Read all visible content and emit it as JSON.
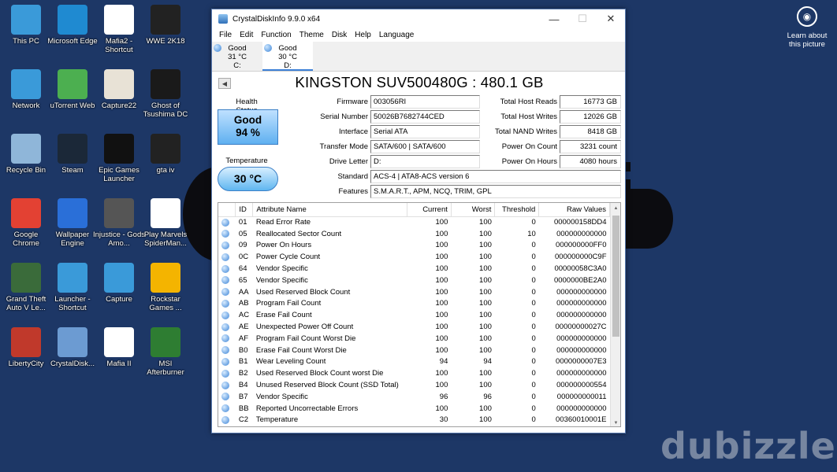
{
  "desktop": {
    "icons": [
      {
        "label": "This PC",
        "color": "#3a9ad9"
      },
      {
        "label": "Microsoft Edge",
        "color": "#1f8ad1"
      },
      {
        "label": "Mafia2 - Shortcut",
        "color": "#ffffff"
      },
      {
        "label": "WWE 2K18",
        "color": "#222222"
      },
      {
        "label": "Network",
        "color": "#3a9ad9"
      },
      {
        "label": "uTorrent Web",
        "color": "#4caf50"
      },
      {
        "label": "Capture22",
        "color": "#e8e2d6"
      },
      {
        "label": "Ghost of Tsushima DC",
        "color": "#1a1a1a"
      },
      {
        "label": "Recycle Bin",
        "color": "#8fb6d9"
      },
      {
        "label": "Steam",
        "color": "#1b2838"
      },
      {
        "label": "Epic Games Launcher",
        "color": "#111111"
      },
      {
        "label": "gta iv",
        "color": "#222222"
      },
      {
        "label": "Google Chrome",
        "color": "#e34133"
      },
      {
        "label": "Wallpaper Engine",
        "color": "#2a6fd8"
      },
      {
        "label": "Injustice - Gods Amo...",
        "color": "#555555"
      },
      {
        "label": "Play Marvels SpiderMan...",
        "color": "#ffffff"
      },
      {
        "label": "Grand Theft Auto V Le...",
        "color": "#3a6b3a"
      },
      {
        "label": "Launcher - Shortcut",
        "color": "#3a9ad9"
      },
      {
        "label": "Capture",
        "color": "#3a9ad9"
      },
      {
        "label": "Rockstar Games ...",
        "color": "#f4b400"
      },
      {
        "label": "LibertyCity",
        "color": "#c0392b"
      },
      {
        "label": "CrystalDisk...",
        "color": "#6c9bd2"
      },
      {
        "label": "Mafia II",
        "color": "#ffffff"
      },
      {
        "label": "MSI Afterburner",
        "color": "#2e7d32"
      }
    ],
    "learn_label": "Learn about this picture",
    "watermark": "dubizzle"
  },
  "window": {
    "title": "CrystalDiskInfo 9.9.0 x64",
    "menu": [
      "File",
      "Edit",
      "Function",
      "Theme",
      "Disk",
      "Help",
      "Language"
    ],
    "drives": [
      {
        "status": "Good",
        "temp": "31 °C",
        "letter": "C:"
      },
      {
        "status": "Good",
        "temp": "30 °C",
        "letter": "D:"
      }
    ],
    "disk_name": "KINGSTON SUV500480G : 480.1 GB",
    "health_label": "Health Status",
    "health_status": "Good",
    "health_percent": "94 %",
    "temp_label": "Temperature",
    "temperature": "30 °C",
    "left_fields": [
      {
        "label": "Firmware",
        "value": "003056RI"
      },
      {
        "label": "Serial Number",
        "value": "50026B7682744CED"
      },
      {
        "label": "Interface",
        "value": "Serial ATA"
      },
      {
        "label": "Transfer Mode",
        "value": "SATA/600 | SATA/600"
      },
      {
        "label": "Drive Letter",
        "value": "D:"
      },
      {
        "label": "Standard",
        "value": "ACS-4 | ATA8-ACS version 6"
      },
      {
        "label": "Features",
        "value": "S.M.A.R.T., APM, NCQ, TRIM, GPL"
      }
    ],
    "right_fields": [
      {
        "label": "Total Host Reads",
        "value": "16773 GB"
      },
      {
        "label": "Total Host Writes",
        "value": "12026 GB"
      },
      {
        "label": "Total NAND Writes",
        "value": "8418 GB"
      },
      {
        "label": "Power On Count",
        "value": "3231 count"
      },
      {
        "label": "Power On Hours",
        "value": "4080 hours"
      }
    ],
    "columns": [
      "ID",
      "Attribute Name",
      "Current",
      "Worst",
      "Threshold",
      "Raw Values"
    ],
    "rows": [
      [
        "01",
        "Read Error Rate",
        "100",
        "100",
        "0",
        "000000158DD4"
      ],
      [
        "05",
        "Reallocated Sector Count",
        "100",
        "100",
        "10",
        "000000000000"
      ],
      [
        "09",
        "Power On Hours",
        "100",
        "100",
        "0",
        "000000000FF0"
      ],
      [
        "0C",
        "Power Cycle Count",
        "100",
        "100",
        "0",
        "000000000C9F"
      ],
      [
        "64",
        "Vendor Specific",
        "100",
        "100",
        "0",
        "00000058C3A0"
      ],
      [
        "65",
        "Vendor Specific",
        "100",
        "100",
        "0",
        "0000000BE2A0"
      ],
      [
        "AA",
        "Used Reserved Block Count",
        "100",
        "100",
        "0",
        "000000000000"
      ],
      [
        "AB",
        "Program Fail Count",
        "100",
        "100",
        "0",
        "000000000000"
      ],
      [
        "AC",
        "Erase Fail Count",
        "100",
        "100",
        "0",
        "000000000000"
      ],
      [
        "AE",
        "Unexpected Power Off Count",
        "100",
        "100",
        "0",
        "00000000027C"
      ],
      [
        "AF",
        "Program Fail Count Worst Die",
        "100",
        "100",
        "0",
        "000000000000"
      ],
      [
        "B0",
        "Erase Fail Count Worst Die",
        "100",
        "100",
        "0",
        "000000000000"
      ],
      [
        "B1",
        "Wear Leveling Count",
        "94",
        "94",
        "0",
        "0000000007E3"
      ],
      [
        "B2",
        "Used Reserved Block Count worst Die",
        "100",
        "100",
        "0",
        "000000000000"
      ],
      [
        "B4",
        "Unused Reserved Block Count (SSD Total)",
        "100",
        "100",
        "0",
        "000000000554"
      ],
      [
        "B7",
        "Vendor Specific",
        "96",
        "96",
        "0",
        "000000000011"
      ],
      [
        "BB",
        "Reported Uncorrectable Errors",
        "100",
        "100",
        "0",
        "000000000000"
      ],
      [
        "C2",
        "Temperature",
        "30",
        "100",
        "0",
        "00360010001E"
      ]
    ]
  }
}
